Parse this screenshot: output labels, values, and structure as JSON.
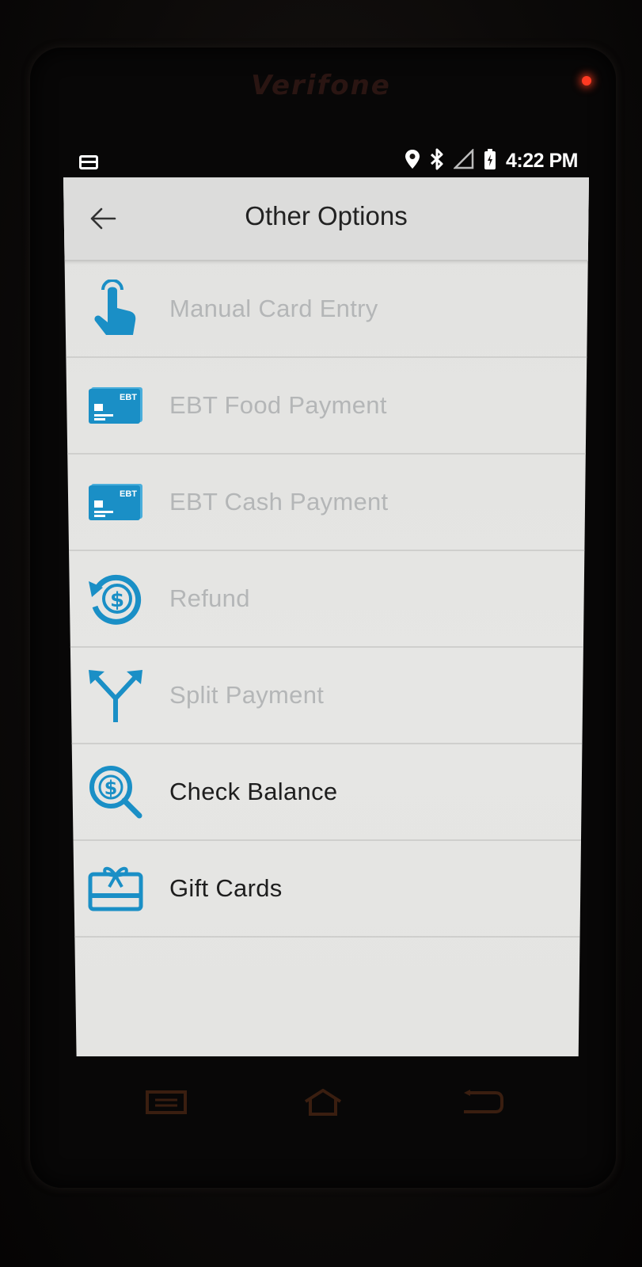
{
  "device": {
    "brand": "Verifone"
  },
  "status_bar": {
    "time": "4:22 PM",
    "icons": [
      "card-notification-icon",
      "location-icon",
      "bluetooth-icon",
      "cell-signal-icon",
      "battery-charging-icon"
    ]
  },
  "header": {
    "title": "Other Options",
    "back_icon": "back-arrow-icon"
  },
  "menu": {
    "items": [
      {
        "label": "Manual Card Entry",
        "icon": "tap-finger-icon",
        "enabled": false
      },
      {
        "label": "EBT Food Payment",
        "icon": "ebt-card-icon",
        "enabled": false,
        "icon_text": "EBT"
      },
      {
        "label": "EBT Cash Payment",
        "icon": "ebt-card-icon",
        "enabled": false,
        "icon_text": "EBT"
      },
      {
        "label": "Refund",
        "icon": "refund-dollar-icon",
        "enabled": false
      },
      {
        "label": "Split Payment",
        "icon": "split-arrows-icon",
        "enabled": false
      },
      {
        "label": "Check Balance",
        "icon": "dollar-search-icon",
        "enabled": true
      },
      {
        "label": "Gift Cards",
        "icon": "gift-card-icon",
        "enabled": true
      }
    ]
  },
  "nav_bar": {
    "icons": [
      "recent-apps-icon",
      "home-icon",
      "back-icon"
    ]
  },
  "colors": {
    "accent": "#1a8fc6",
    "disabled_text": "#b4b6b7",
    "enabled_text": "#1e1e1e",
    "nav_buttons": "#3a1e10",
    "led": "#ff3a22"
  }
}
